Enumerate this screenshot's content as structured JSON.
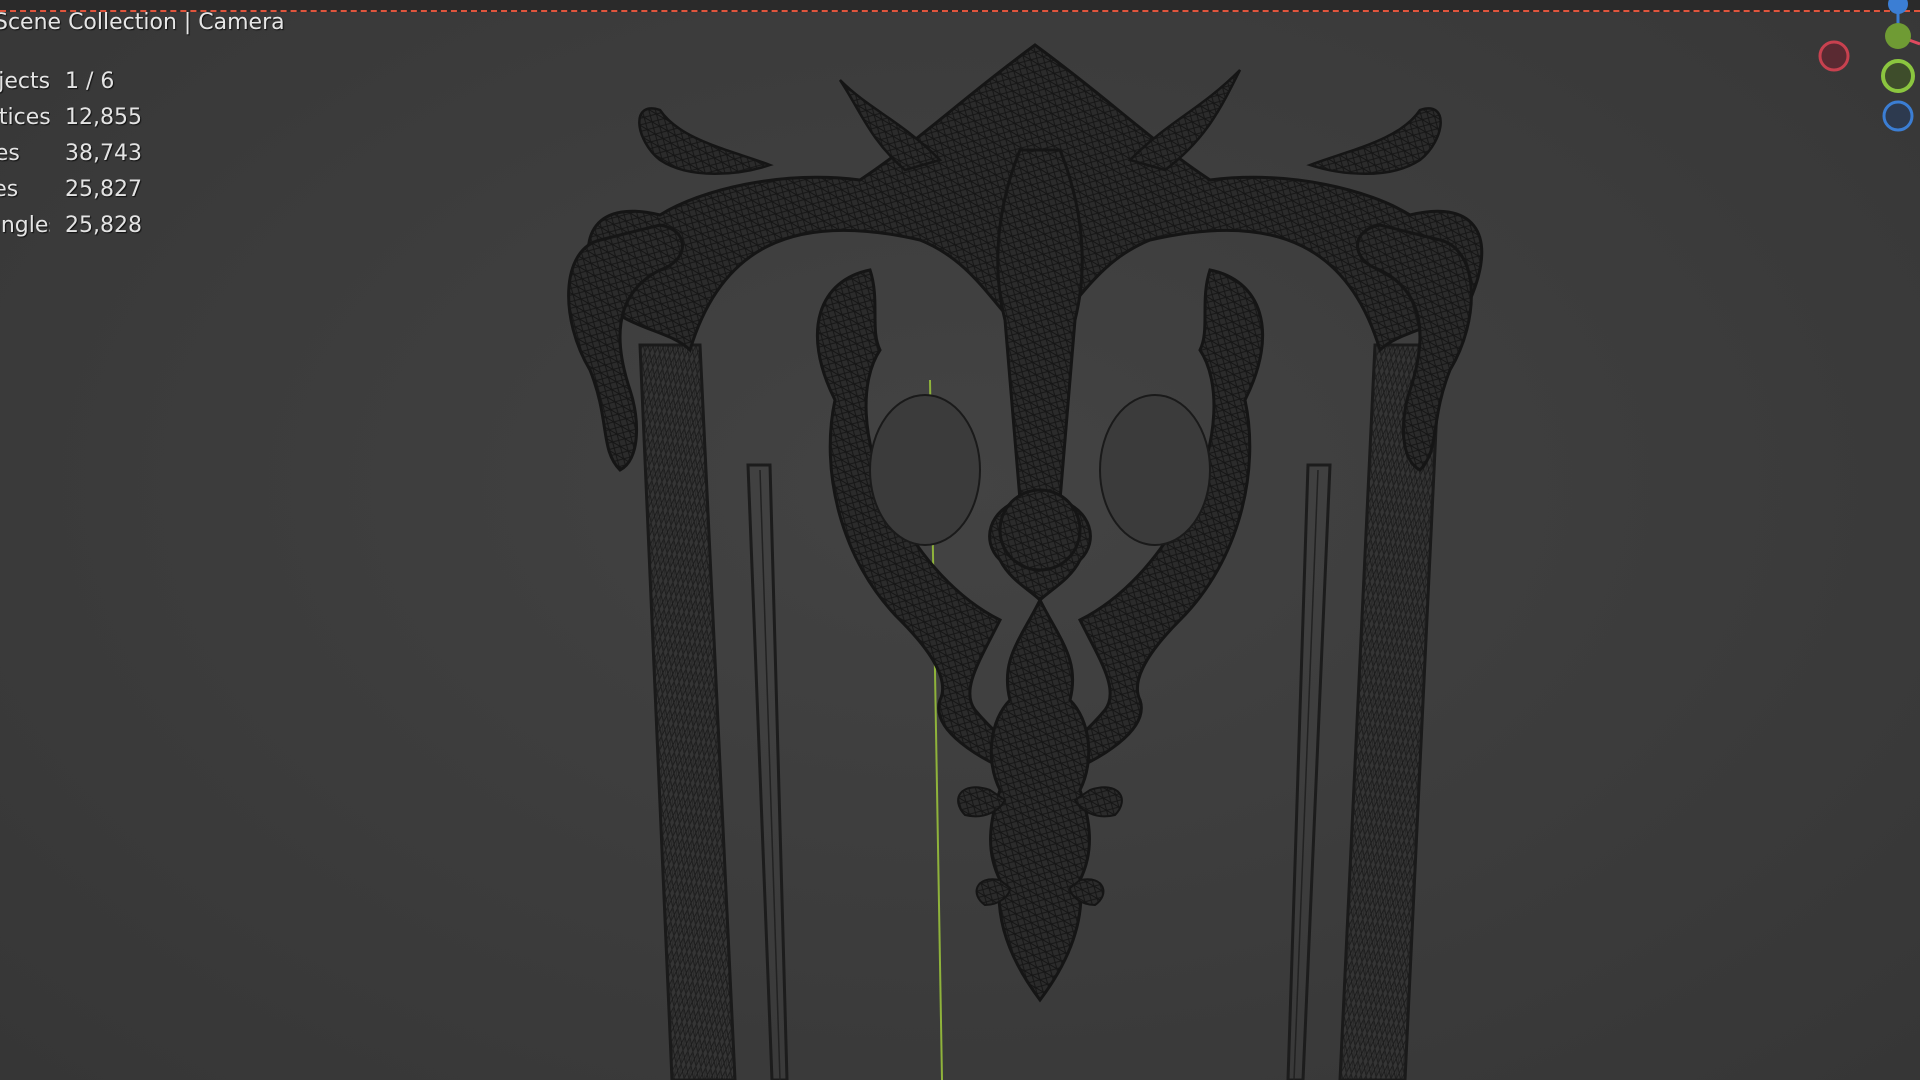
{
  "header": {
    "text": "Scene Collection | Camera"
  },
  "stats": [
    {
      "label": "Objects",
      "value": "1 / 6"
    },
    {
      "label": "Vertices",
      "value": "12,855"
    },
    {
      "label": "Edges",
      "value": "38,743"
    },
    {
      "label": "Faces",
      "value": "25,827"
    },
    {
      "label": "Triangles",
      "value": "25,828"
    }
  ],
  "gizmo": {
    "x_axis_color": "#e04a5f",
    "y_axis_color": "#8bc63f",
    "z_axis_color": "#3b7ed4"
  },
  "colors": {
    "background": "#3d3d3d",
    "wireframe": "#1a1a1a",
    "y_axis_line": "#8fb33b"
  }
}
